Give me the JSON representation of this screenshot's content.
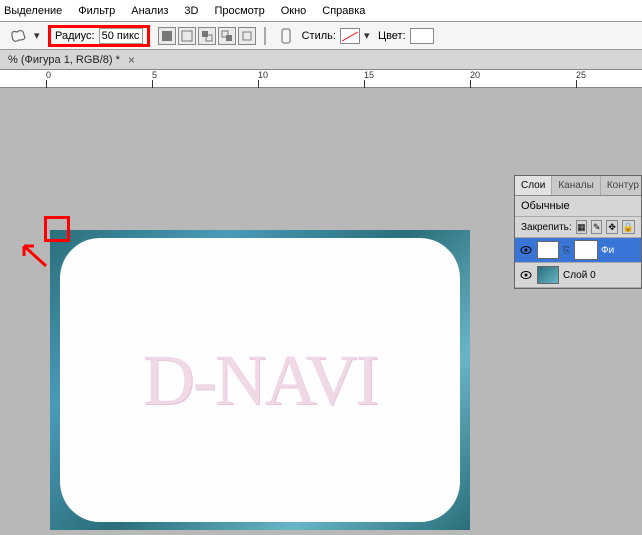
{
  "menu": {
    "items": [
      "Выделение",
      "Фильтр",
      "Анализ",
      "3D",
      "Просмотр",
      "Окно",
      "Справка"
    ]
  },
  "options": {
    "radius_label": "Радиус:",
    "radius_value": "50 пикс",
    "style_label": "Стиль:",
    "color_label": "Цвет:"
  },
  "doc_tab": {
    "title": "% (Фигура 1, RGB/8) *"
  },
  "ruler": {
    "ticks": [
      "0",
      "5",
      "10",
      "15",
      "20",
      "25"
    ]
  },
  "canvas": {
    "watermark": "D-NAVI"
  },
  "panel": {
    "tabs": [
      "Слои",
      "Каналы",
      "Контур"
    ],
    "blend_mode": "Обычные",
    "lock_label": "Закрепить:",
    "layers": [
      {
        "name": "Фи"
      },
      {
        "name": "Слой 0"
      }
    ]
  },
  "colors": {
    "highlight": "#ff0000",
    "accent": "#3875d7"
  }
}
